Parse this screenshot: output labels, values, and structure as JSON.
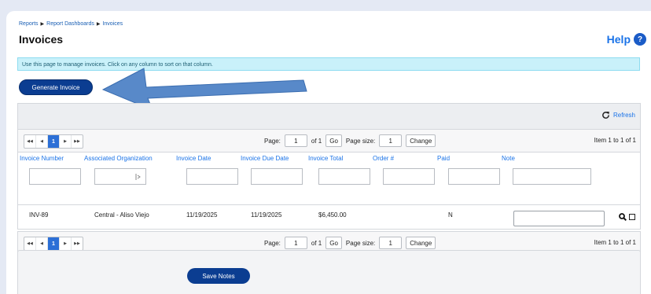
{
  "breadcrumb": [
    "Reports",
    "Report Dashboards",
    "Invoices"
  ],
  "page_title": "Invoices",
  "help": {
    "label": "Help",
    "icon_glyph": "?"
  },
  "info_text": "Use this page to manage invoices. Click on any column to sort on that column.",
  "generate_button": "Generate Invoice",
  "refresh_label": "Refresh",
  "pager": {
    "current_page": "1",
    "page_label": "Page:",
    "page_value": "1",
    "of_label": "of 1",
    "go_label": "Go",
    "page_size_label": "Page size:",
    "page_size_value": "1",
    "change_label": "Change",
    "item_summary": "Item 1 to 1 of 1"
  },
  "columns": [
    "Invoice Number",
    "Associated Organization",
    "Invoice Date",
    "Invoice Due Date",
    "Invoice Total",
    "Order #",
    "Paid",
    "Note"
  ],
  "rows": [
    {
      "invoice_number": "INV-89",
      "organization": "Central - Aliso Viejo",
      "invoice_date": "11/19/2025",
      "due_date": "11/19/2025",
      "total": "$6,450.00",
      "order": "",
      "paid": "N",
      "note": ""
    }
  ],
  "save_notes_button": "Save Notes",
  "colors": {
    "accent": "#1a73e8",
    "button": "#0b3d91",
    "info_bg": "#c9f1fa",
    "arrow": "#4a7fc4"
  }
}
